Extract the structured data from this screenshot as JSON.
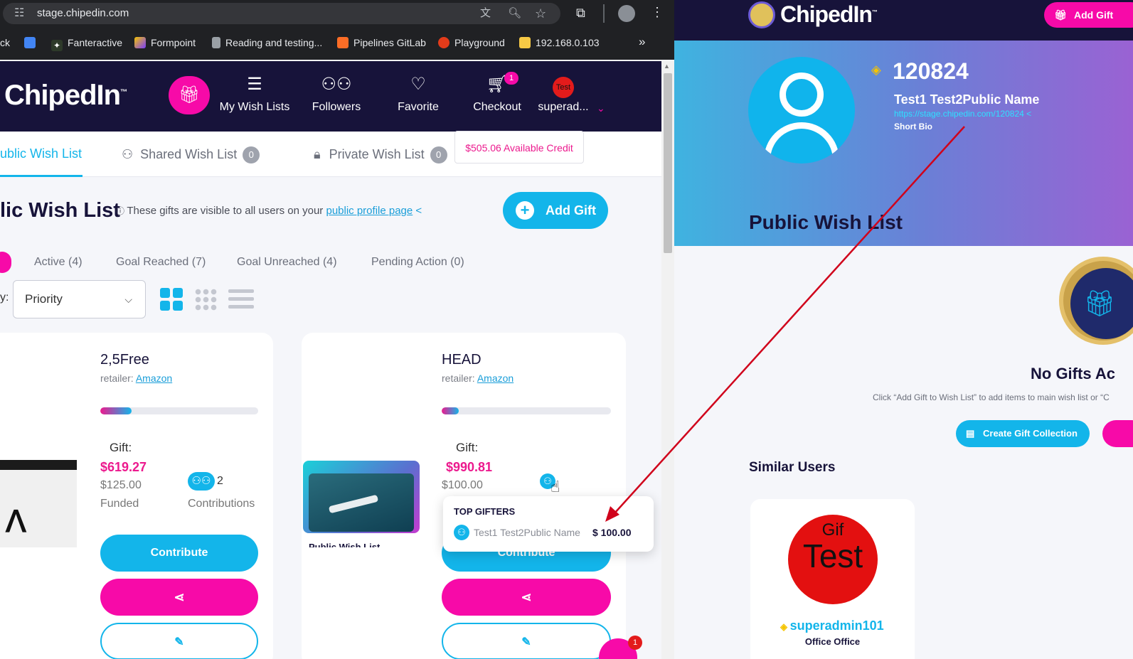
{
  "browser": {
    "url": "stage.chipedin.com",
    "bookmarks": [
      "ck",
      "Fanteractive",
      "Formpoint",
      "Reading and testing...",
      "Pipelines GitLab",
      "Playground",
      "192.168.0.103"
    ],
    "more": "»"
  },
  "site": {
    "logo": "ChipedIn",
    "logo_tm": "™",
    "nav": [
      {
        "label": "My Wish Lists",
        "icon": "wishlist-icon"
      },
      {
        "label": "Followers",
        "icon": "followers-icon"
      },
      {
        "label": "Favorite",
        "icon": "heart-icon"
      },
      {
        "label": "Checkout",
        "icon": "cart-icon",
        "badge": "1"
      },
      {
        "label": "superad...",
        "icon": "avatar",
        "avatar_text": "Test"
      }
    ]
  },
  "tabs": [
    {
      "label": "ublic Wish List",
      "active": true
    },
    {
      "label": "Shared Wish List",
      "count": "0"
    },
    {
      "label": "Private Wish List",
      "count": "0"
    }
  ],
  "credit": "$505.06 Available Credit",
  "list": {
    "title": "lic Wish List",
    "note_prefix": "These gifts are visible to all users on your",
    "note_link": "public profile page",
    "add_gift": "Add Gift"
  },
  "filters": [
    "Active (4)",
    "Goal Reached (7)",
    "Goal Unreached (4)",
    "Pending Action (0)"
  ],
  "sort": {
    "label": "y:",
    "value": "Priority"
  },
  "cards": [
    {
      "title": "2,5Free",
      "retailer_label": "retailer:",
      "retailer": "Amazon",
      "progress": 0.2,
      "gift_label": "Gift:",
      "price": "$619.27",
      "funded_amount": "$125.00",
      "funded_label": "Funded",
      "contrib_count": "2",
      "contrib_label": "Contributions",
      "contribute": "Contribute"
    },
    {
      "title": "HEAD",
      "retailer_label": "retailer:",
      "retailer": "Amazon",
      "progress": 0.1,
      "gift_label": "Gift:",
      "price": "$990.81",
      "funded_amount": "$100.00",
      "image_caption": "Public Wish List",
      "contribute": "Contribute"
    }
  ],
  "tooltip": {
    "title": "TOP GIFTERS",
    "name": "Test1 Test2Public Name",
    "amount": "$ 100.00"
  },
  "chat_badge": "1",
  "right": {
    "logo": "ChipedIn",
    "add_gift": "Add Gift",
    "profile_id": "120824",
    "name": "Test1 Test2Public Name",
    "url": "https://stage.chipedin.com/120824",
    "bio": "Short Bio",
    "section_title": "Public Wish List",
    "empty_title": "No Gifts Ac",
    "empty_desc": "Click “Add Gift to Wish List” to add items to main wish list or “C",
    "create_collection": "Create Gift Collection",
    "similar_title": "Similar Users",
    "user": {
      "avatar_small": "Gif",
      "avatar_big": "Test",
      "name": "superadmin101",
      "org": "Office Office"
    }
  },
  "colors": {
    "navy": "#17133a",
    "cyan": "#13b5ea",
    "magenta": "#f70aa8",
    "pink": "#ec1a8e",
    "arrow": "#d0021b"
  }
}
